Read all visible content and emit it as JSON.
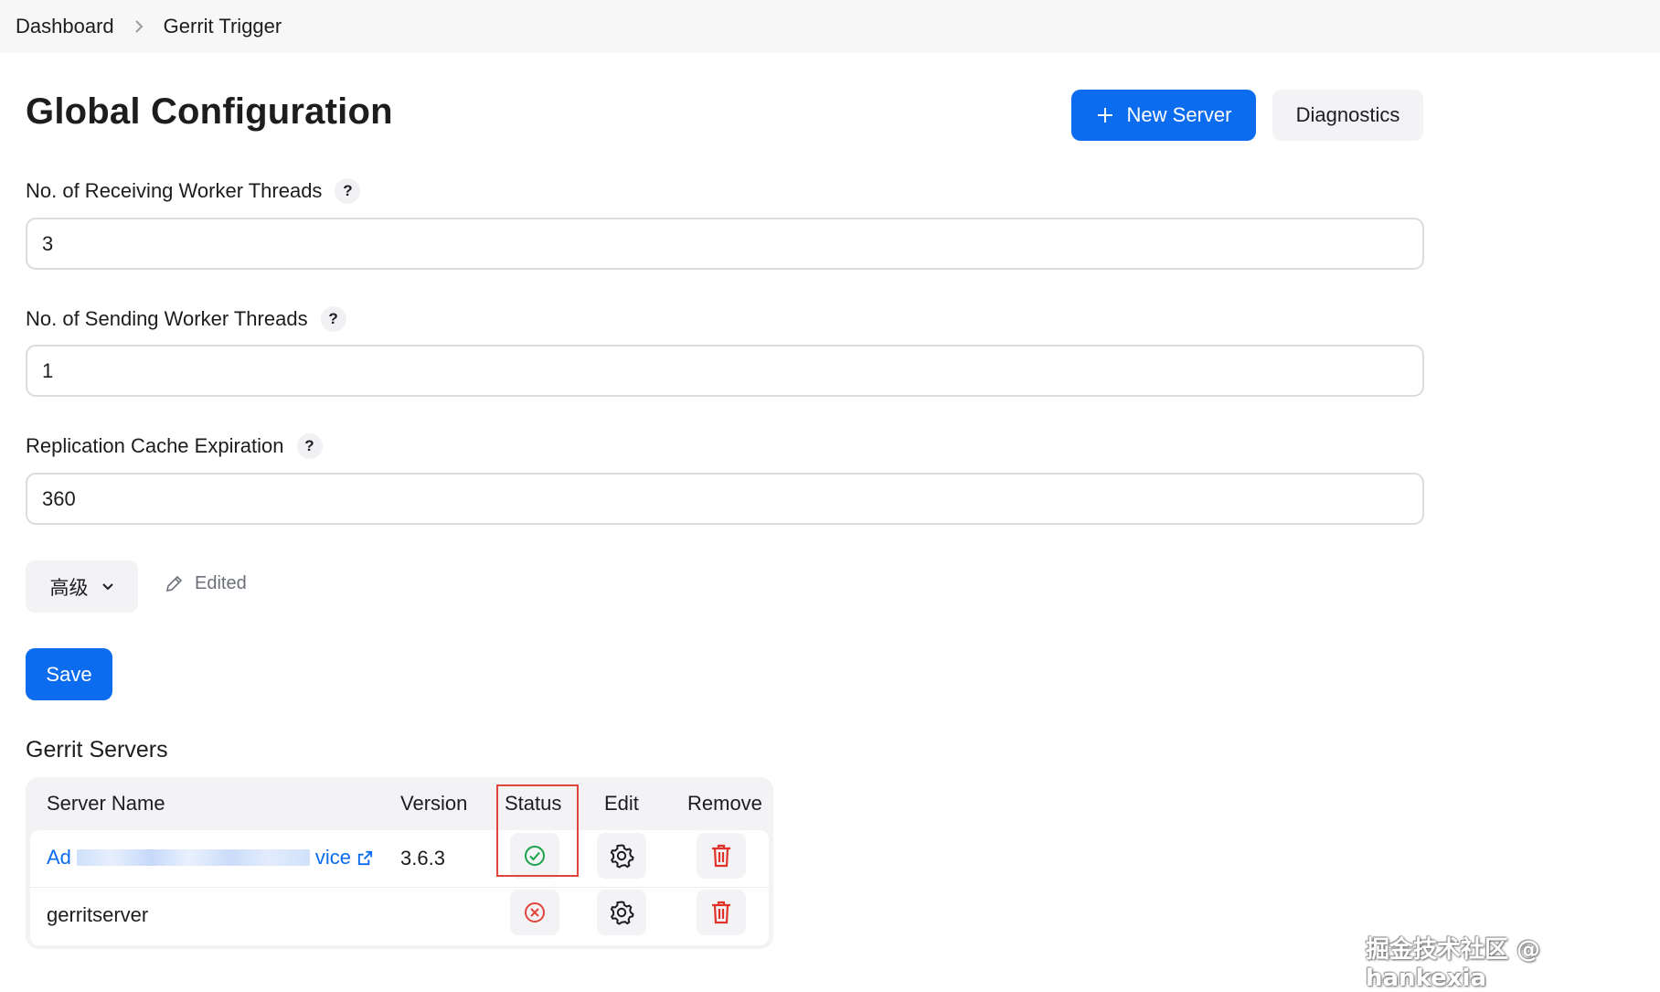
{
  "breadcrumb": {
    "items": [
      "Dashboard",
      "Gerrit Trigger"
    ]
  },
  "page": {
    "title": "Global Configuration"
  },
  "actions": {
    "new_server": "New Server",
    "diagnostics": "Diagnostics"
  },
  "fields": [
    {
      "label": "No. of Receiving Worker Threads",
      "help": "?",
      "value": "3"
    },
    {
      "label": "No. of Sending Worker Threads",
      "help": "?",
      "value": "1"
    },
    {
      "label": "Replication Cache Expiration",
      "help": "?",
      "value": "360"
    }
  ],
  "advanced": {
    "label": "高级",
    "edited": "Edited"
  },
  "save_label": "Save",
  "servers": {
    "title": "Gerrit Servers",
    "columns": [
      "Server Name",
      "Version",
      "Status",
      "Edit",
      "Remove"
    ],
    "rows": [
      {
        "name_prefix": "Ad",
        "name_suffix": "vice",
        "version": "3.6.3",
        "status": "ok"
      },
      {
        "name": "gerritserver",
        "version": "",
        "status": "error"
      }
    ]
  },
  "colors": {
    "accent": "#0b6cf0",
    "ok": "#1aa34a",
    "error": "#e0443b",
    "remove": "#e0312a"
  },
  "watermark": "掘金技术社区 @ hankexia"
}
